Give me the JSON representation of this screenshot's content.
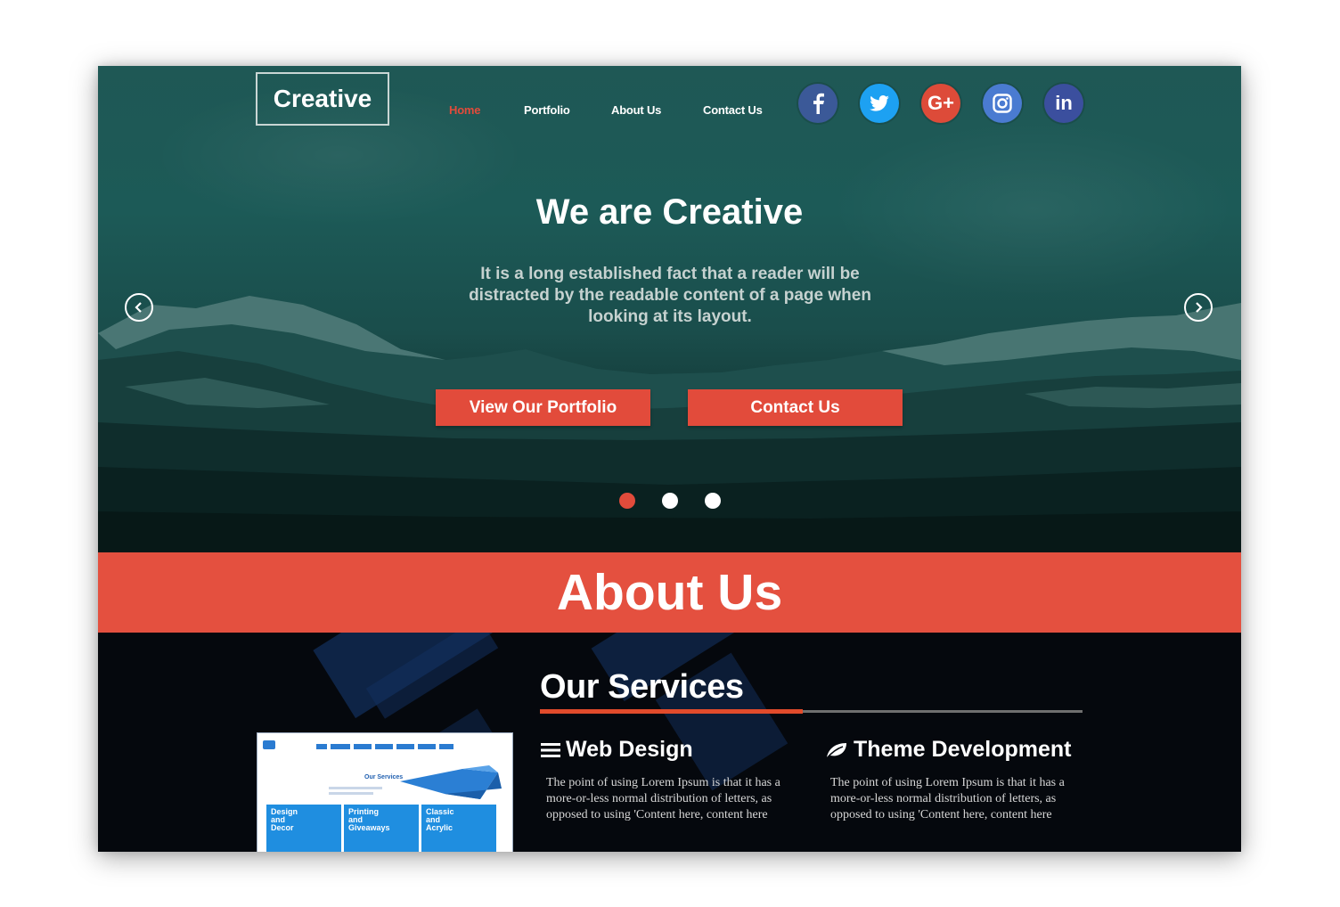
{
  "brand": {
    "name": "Creative"
  },
  "nav": {
    "items": [
      {
        "label": "Home",
        "active": true
      },
      {
        "label": "Portfolio",
        "active": false
      },
      {
        "label": "About Us",
        "active": false
      },
      {
        "label": "Contact Us",
        "active": false
      }
    ]
  },
  "social": [
    {
      "icon": "facebook-icon",
      "glyph": "f",
      "color": "#3b5998"
    },
    {
      "icon": "twitter-icon",
      "glyph": "t",
      "color": "#1da1f2"
    },
    {
      "icon": "google-plus-icon",
      "glyph": "G+",
      "color": "#dd4b39"
    },
    {
      "icon": "instagram-icon",
      "glyph": "ig",
      "color": "#4a7bd1"
    },
    {
      "icon": "linkedin-icon",
      "glyph": "in",
      "color": "#3b4f9e"
    }
  ],
  "hero": {
    "title": "We are Creative",
    "text": "It is a long established fact that a reader will be distracted by the readable content of a page when looking at its layout.",
    "buttons": {
      "portfolio": "View Our Portfolio",
      "contact": "Contact Us"
    },
    "slides": {
      "count": 3,
      "active": 1
    }
  },
  "about": {
    "title": "About Us"
  },
  "services": {
    "title": "Our Services",
    "items": [
      {
        "icon": "bars-icon",
        "title": "Web Design",
        "text": "The point of using Lorem Ipsum is that it has a more-or-less normal distribution of letters, as opposed to using 'Content here, content here"
      },
      {
        "icon": "leaf-icon",
        "title": "Theme Development",
        "text": "The point of using Lorem Ipsum is that it has a more-or-less normal distribution of letters, as opposed to using 'Content here, content here"
      }
    ],
    "thumbnail": {
      "heading": "Our Services",
      "tiles": [
        {
          "lines": [
            "Design",
            "and",
            "Decor"
          ]
        },
        {
          "lines": [
            "Printing",
            "and",
            "Giveaways"
          ]
        },
        {
          "lines": [
            "Classic",
            "and",
            "Acrylic"
          ]
        }
      ]
    }
  },
  "colors": {
    "accent": "#e24b3b",
    "hero": "#1c5a57",
    "services_bg": "#05080d"
  }
}
